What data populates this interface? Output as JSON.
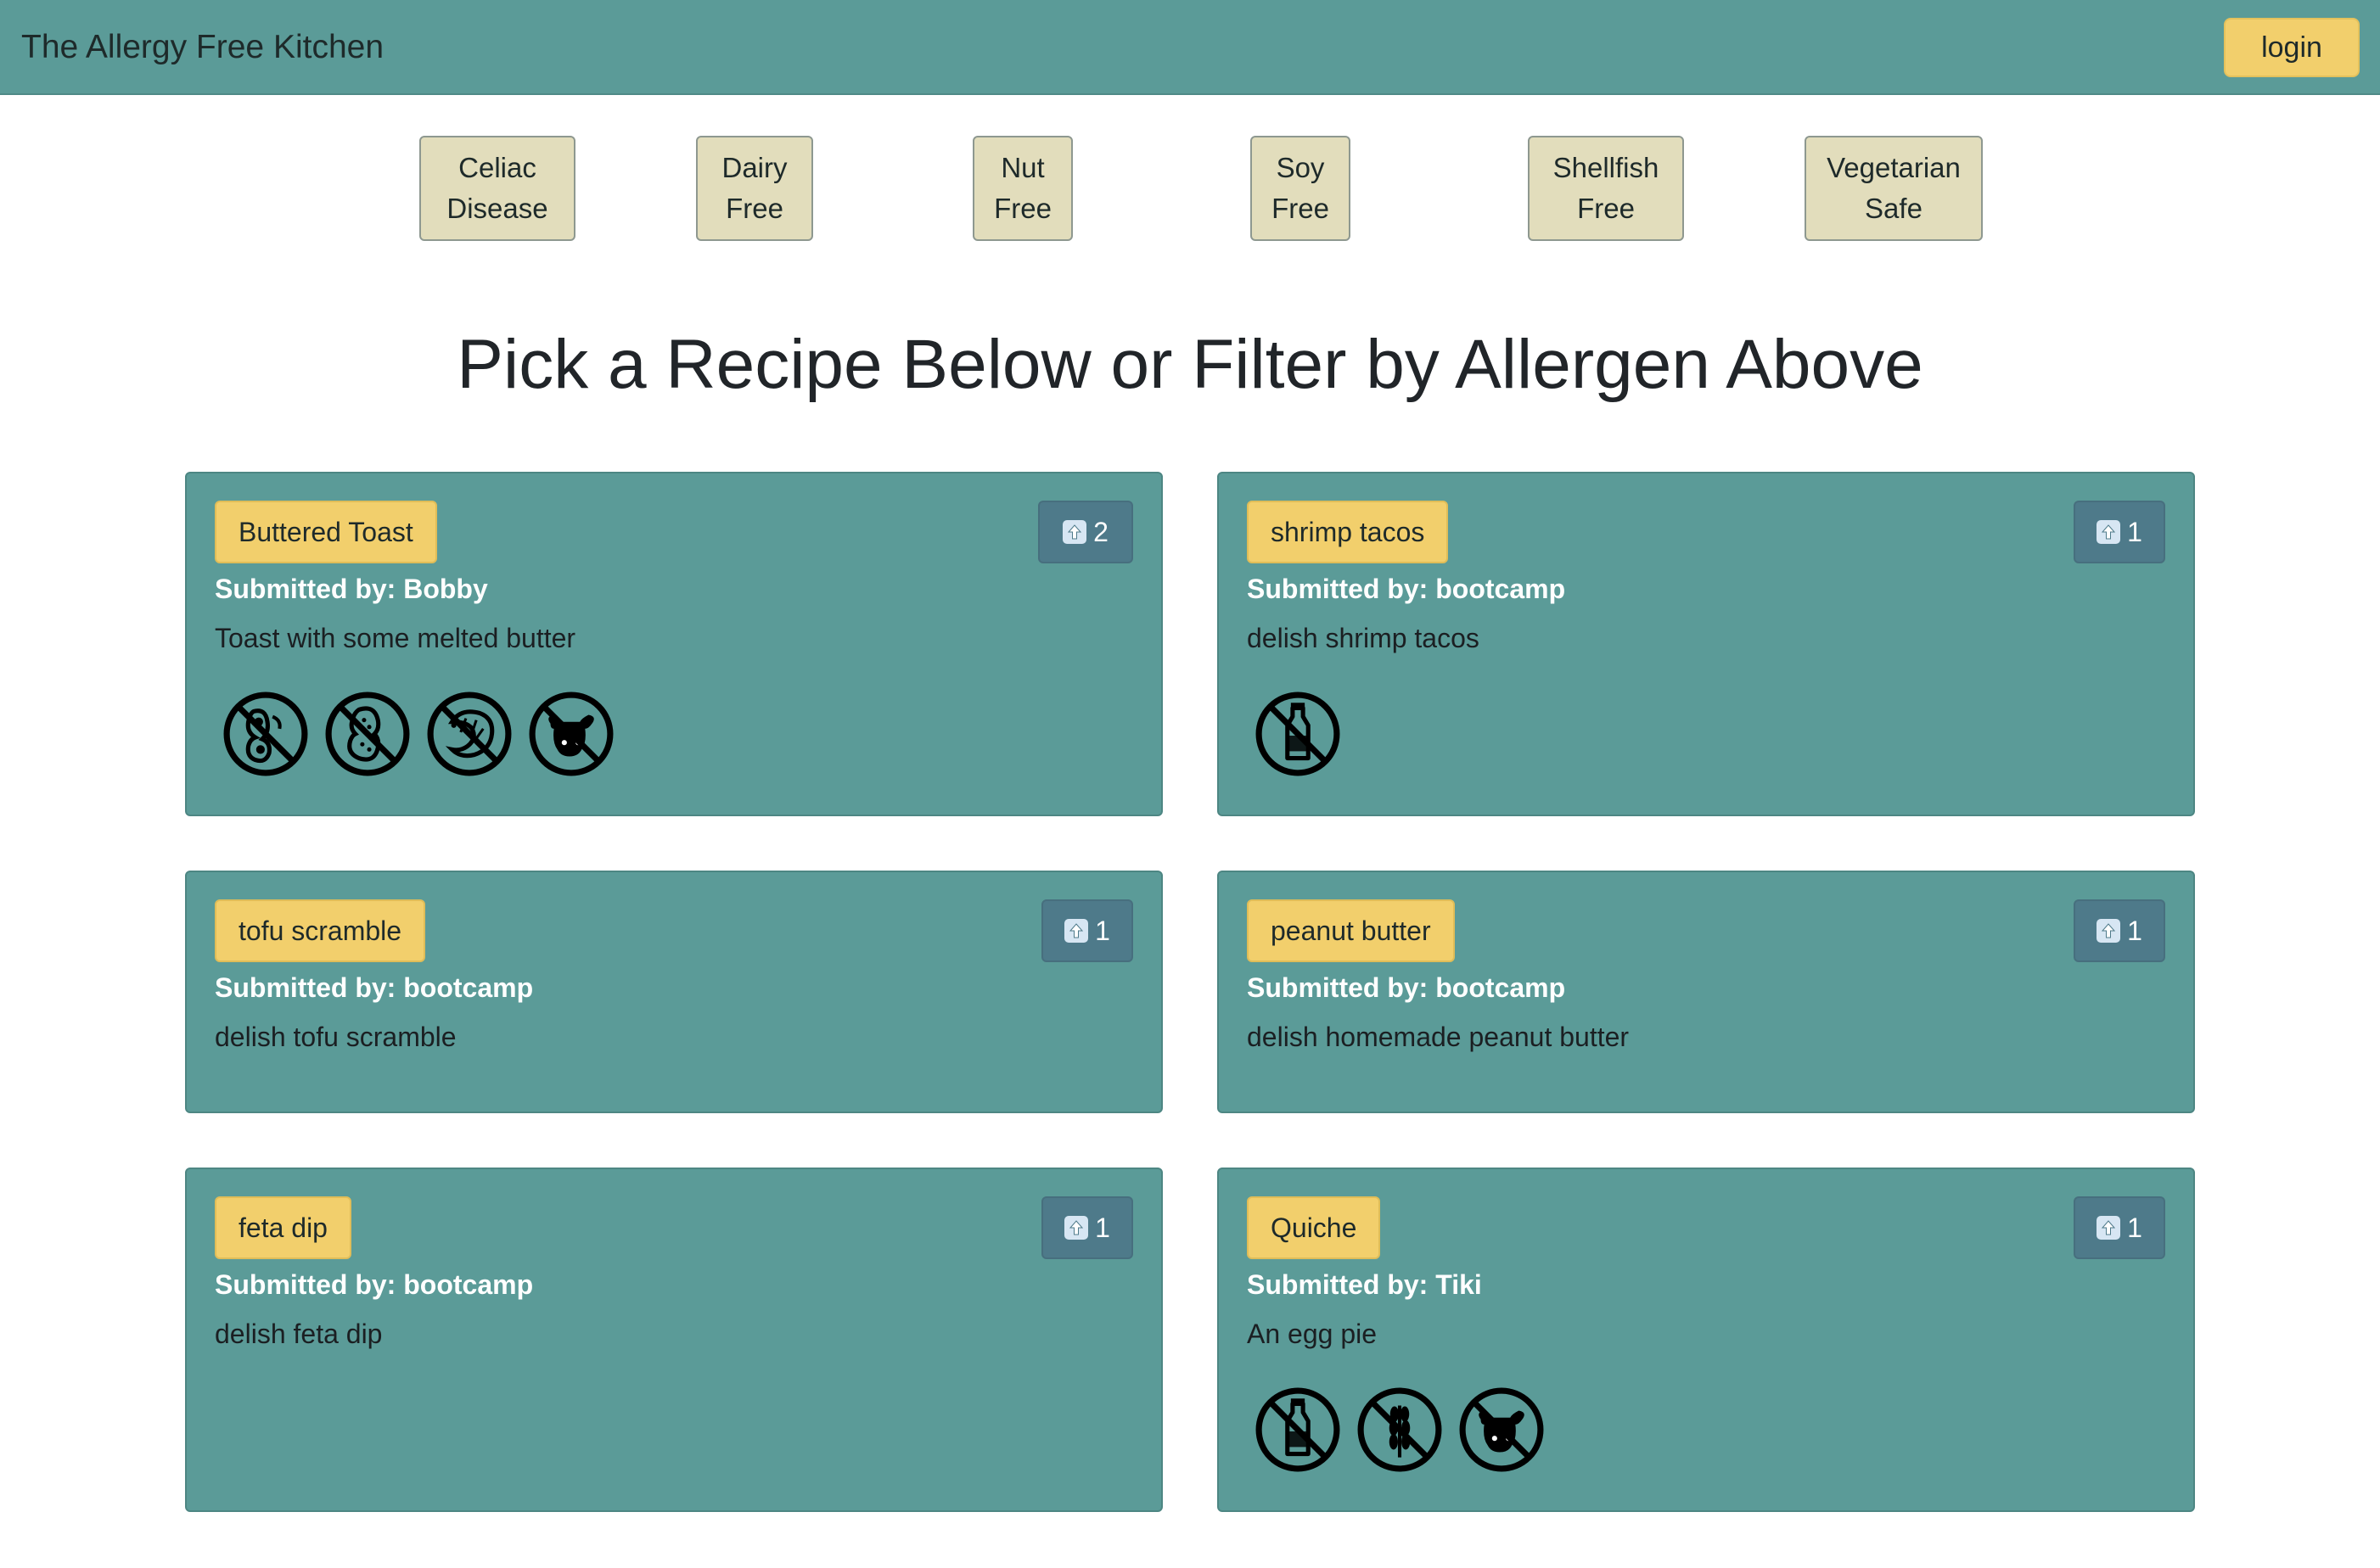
{
  "app": {
    "brand": "The Allergy Free Kitchen",
    "login_label": "login"
  },
  "filters": [
    {
      "line1": "Celiac",
      "line2": "Disease"
    },
    {
      "line1": "Dairy",
      "line2": "Free"
    },
    {
      "line1": "Nut",
      "line2": "Free"
    },
    {
      "line1": "Soy",
      "line2": "Free"
    },
    {
      "line1": "Shellfish",
      "line2": "Free"
    },
    {
      "line1": "Vegetarian",
      "line2": "Safe"
    }
  ],
  "headline": "Pick a Recipe Below or Filter by Allergen Above",
  "colors": {
    "navbar": "#5b9b98",
    "card": "#5b9b98",
    "title_badge": "#f2cf6c",
    "vote_button": "#4e7a8a",
    "filter_button": "#e2ddbc"
  },
  "recipes": [
    {
      "title": "Buttered Toast",
      "votes": "2",
      "submitted": "Submitted by: Bobby",
      "description": "Toast with some melted butter",
      "icons": [
        "no-soy-icon",
        "no-peanut-icon",
        "no-shellfish-icon",
        "no-meat-icon"
      ]
    },
    {
      "title": "shrimp tacos",
      "votes": "1",
      "submitted": "Submitted by: bootcamp",
      "description": "delish shrimp tacos",
      "icons": [
        "no-dairy-icon"
      ]
    },
    {
      "title": "tofu scramble",
      "votes": "1",
      "submitted": "Submitted by: bootcamp",
      "description": "delish tofu scramble",
      "icons": []
    },
    {
      "title": "peanut butter",
      "votes": "1",
      "submitted": "Submitted by: bootcamp",
      "description": "delish homemade peanut butter",
      "icons": []
    },
    {
      "title": "feta dip",
      "votes": "1",
      "submitted": "Submitted by: bootcamp",
      "description": "delish feta dip",
      "icons": []
    },
    {
      "title": "Quiche",
      "votes": "1",
      "submitted": "Submitted by: Tiki",
      "description": "An egg pie",
      "icons": [
        "no-dairy-icon",
        "no-gluten-icon",
        "no-meat-icon"
      ]
    }
  ]
}
